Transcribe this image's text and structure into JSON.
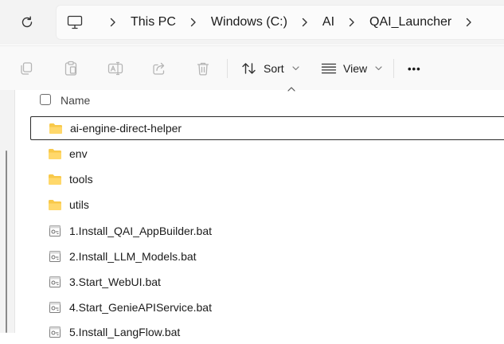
{
  "address_bar": {
    "breadcrumbs": [
      "This PC",
      "Windows (C:)",
      "AI",
      "QAI_Launcher"
    ]
  },
  "toolbar": {
    "sort_label": "Sort",
    "view_label": "View",
    "more_label": "•••"
  },
  "file_list": {
    "column_name": "Name",
    "items": [
      {
        "name": "ai-engine-direct-helper",
        "type": "folder"
      },
      {
        "name": "env",
        "type": "folder"
      },
      {
        "name": "tools",
        "type": "folder"
      },
      {
        "name": "utils",
        "type": "folder"
      },
      {
        "name": "1.Install_QAI_AppBuilder.bat",
        "type": "bat"
      },
      {
        "name": "2.Install_LLM_Models.bat",
        "type": "bat"
      },
      {
        "name": "3.Start_WebUI.bat",
        "type": "bat"
      },
      {
        "name": "4.Start_GenieAPIService.bat",
        "type": "bat"
      },
      {
        "name": "5.Install_LangFlow.bat",
        "type": "bat"
      }
    ]
  }
}
